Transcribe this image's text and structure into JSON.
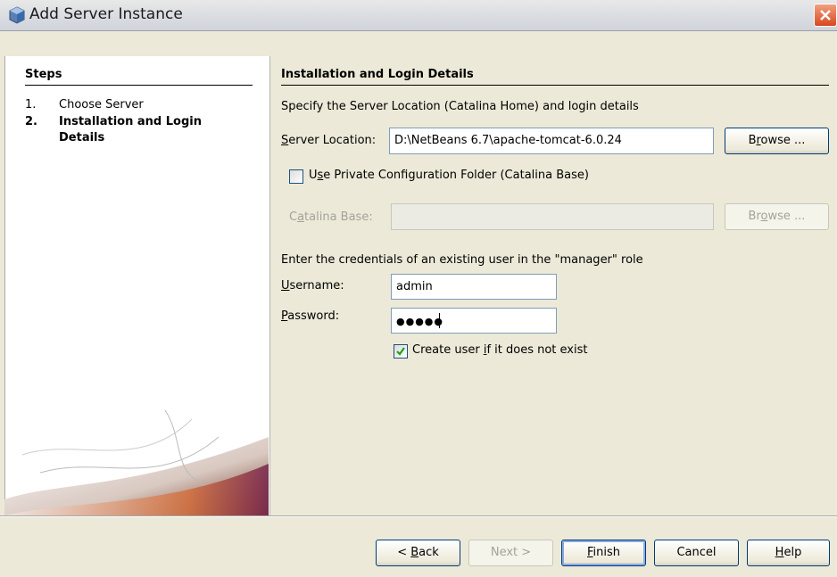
{
  "window": {
    "title": "Add Server Instance"
  },
  "steps": {
    "heading": "Steps",
    "items": [
      {
        "num": "1.",
        "label": "Choose Server"
      },
      {
        "num": "2.",
        "label_line1": "Installation and Login",
        "label_line2": "Details"
      }
    ]
  },
  "main": {
    "heading": "Installation and Login Details",
    "intro": "Specify the Server Location (Catalina Home) and login details",
    "server_location": {
      "label_mnemonic": "S",
      "label_rest": "erver Location:",
      "value": "D:\\NetBeans 6.7\\apache-tomcat-6.0.24",
      "browse": {
        "pre": "B",
        "mn": "r",
        "post": "owse ..."
      }
    },
    "private_config": {
      "pre": "U",
      "mn": "s",
      "post": "e Private Configuration Folder (Catalina Base)",
      "checked": false
    },
    "catalina_base": {
      "pre": "C",
      "mn": "a",
      "post": "talina Base:",
      "value": "",
      "browse": {
        "pre": "Br",
        "mn": "o",
        "post": "wse ..."
      }
    },
    "credentials_intro": "Enter the credentials of an existing user in the \"manager\" role",
    "username": {
      "mn": "U",
      "rest": "sername:",
      "value": "admin"
    },
    "password": {
      "mn": "P",
      "rest": "assword:",
      "value": "●●●●●"
    },
    "create_user": {
      "pre": "Create user ",
      "mn": "i",
      "post": "f it does not exist",
      "checked": true
    }
  },
  "footer": {
    "back": {
      "pre": "< ",
      "mn": "B",
      "post": "ack"
    },
    "next": "Next >",
    "finish": {
      "mn": "F",
      "post": "inish"
    },
    "cancel": "Cancel",
    "help": {
      "mn": "H",
      "post": "elp"
    }
  }
}
